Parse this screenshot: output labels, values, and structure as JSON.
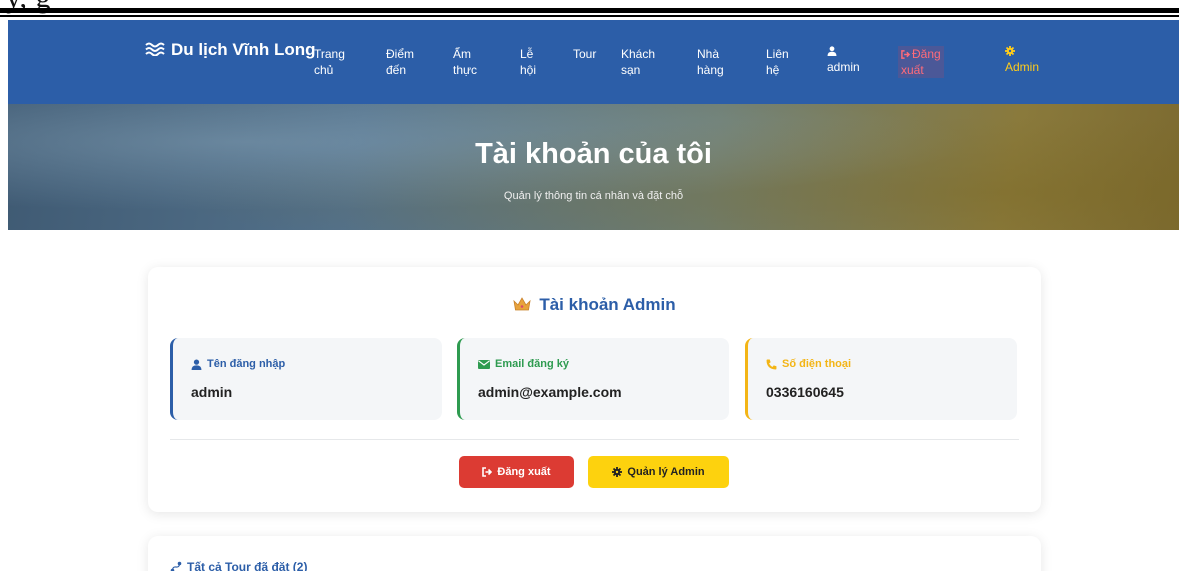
{
  "doc_header": {
    "text": "y, g"
  },
  "navbar": {
    "brand": "Du lịch Vĩnh Long",
    "items": [
      {
        "line1": "Trang",
        "line2": "chủ"
      },
      {
        "line1": "Điểm",
        "line2": "đến"
      },
      {
        "line1": "Ẩm",
        "line2": "thực"
      },
      {
        "line1": "Lễ",
        "line2": "hội"
      },
      {
        "line1": "Tour",
        "line2": ""
      },
      {
        "line1": "Khách",
        "line2": "sạn"
      },
      {
        "line1": "Nhà",
        "line2": "hàng"
      },
      {
        "line1": "Liên",
        "line2": "hệ"
      }
    ],
    "user": "admin",
    "logout": {
      "line1": "Đăng",
      "line2": "xuất"
    },
    "admin": "Admin"
  },
  "hero": {
    "title": "Tài khoản của tôi",
    "subtitle": "Quản lý thông tin cá nhân và đặt chỗ"
  },
  "account_card": {
    "title": "Tài khoản Admin",
    "username": {
      "label": "Tên đăng nhập",
      "value": "admin"
    },
    "email": {
      "label": "Email đăng ký",
      "value": "admin@example.com"
    },
    "phone": {
      "label": "Số điện thoại",
      "value": "0336160645"
    },
    "logout_button": "Đăng xuất",
    "admin_button": "Quản lý Admin"
  },
  "tours_card": {
    "title": "Tất cả Tour đã đặt (2)"
  },
  "colors": {
    "primary": "#2c5ea8",
    "danger": "#dc3b33",
    "warning": "#fdd20e",
    "success": "#2e9b50"
  }
}
